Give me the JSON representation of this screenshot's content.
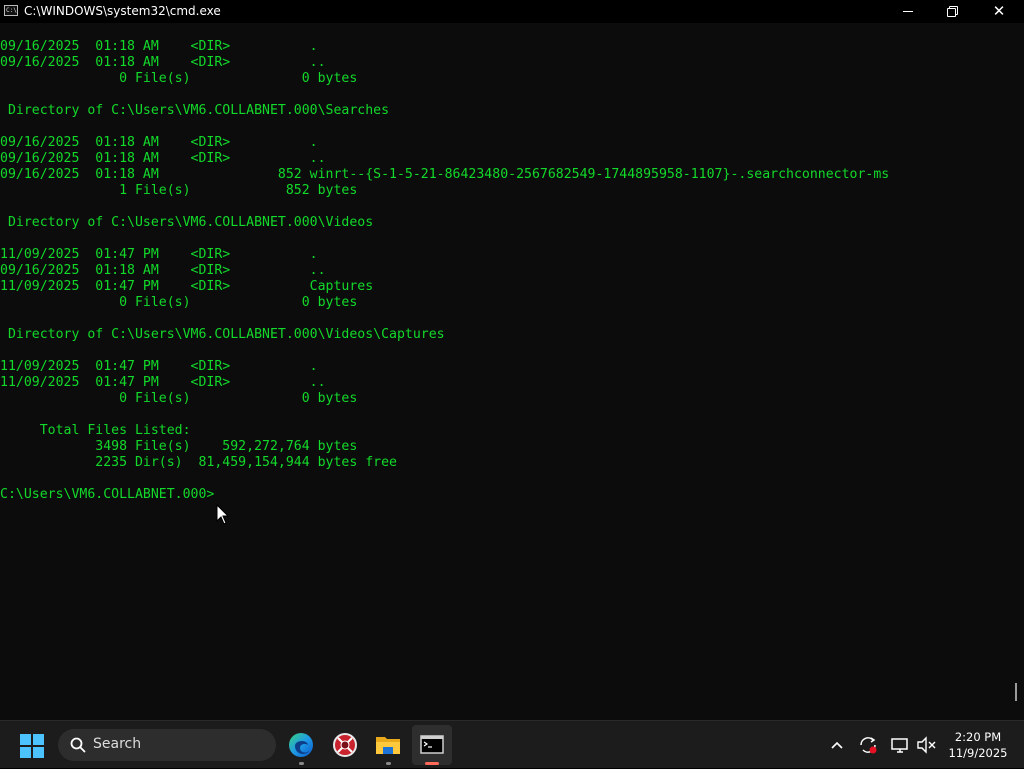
{
  "window": {
    "title": "C:\\WINDOWS\\system32\\cmd.exe",
    "icon_text": "C:\\",
    "close_glyph": "✕"
  },
  "console": {
    "text_color": "#13d92a",
    "lines": [
      "09/16/2025  01:18 AM    <DIR>          .",
      "09/16/2025  01:18 AM    <DIR>          ..",
      "               0 File(s)              0 bytes",
      "",
      " Directory of C:\\Users\\VM6.COLLABNET.000\\Searches",
      "",
      "09/16/2025  01:18 AM    <DIR>          .",
      "09/16/2025  01:18 AM    <DIR>          ..",
      "09/16/2025  01:18 AM               852 winrt--{S-1-5-21-86423480-2567682549-1744895958-1107}-.searchconnector-ms",
      "               1 File(s)            852 bytes",
      "",
      " Directory of C:\\Users\\VM6.COLLABNET.000\\Videos",
      "",
      "11/09/2025  01:47 PM    <DIR>          .",
      "09/16/2025  01:18 AM    <DIR>          ..",
      "11/09/2025  01:47 PM    <DIR>          Captures",
      "               0 File(s)              0 bytes",
      "",
      " Directory of C:\\Users\\VM6.COLLABNET.000\\Videos\\Captures",
      "",
      "11/09/2025  01:47 PM    <DIR>          .",
      "11/09/2025  01:47 PM    <DIR>          ..",
      "               0 File(s)              0 bytes",
      "",
      "     Total Files Listed:",
      "            3498 File(s)    592,272,764 bytes",
      "            2235 Dir(s)  81,459,154,944 bytes free",
      "",
      "C:\\Users\\VM6.COLLABNET.000>"
    ]
  },
  "taskbar": {
    "search_label": "Search",
    "accent": "#4cc2ff",
    "apps": [
      "edge-icon",
      "red-app-icon",
      "file-explorer-icon",
      "command-prompt-icon"
    ],
    "clock": {
      "time": "2:20 PM",
      "date": "11/9/2025"
    }
  }
}
